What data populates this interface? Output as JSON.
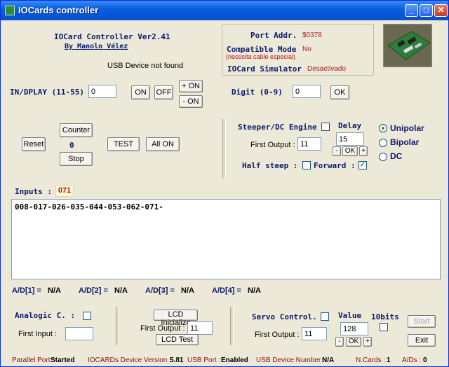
{
  "window": {
    "title": "IOCards controller",
    "min": "_",
    "max": "□",
    "close": "✕"
  },
  "header": {
    "app_name": "IOCard Controller  Ver2.41",
    "author": "By Manolo Vélez",
    "usb_status": "USB Device not found",
    "port_addr_label": "Port Addr.",
    "port_addr_value": "$0378",
    "compatible_label": "Compatible Mode",
    "compatible_value": "No",
    "compatible_note": "(necesita cable especial)",
    "simulator_label": "IOCard Simulator",
    "simulator_value": "Desactivado"
  },
  "display": {
    "label": "IN/DPLAY (11-55)",
    "value": "0",
    "on": "ON",
    "off": "OFF",
    "plus_on": "+ ON",
    "minus_on": "- ON",
    "digit_label": "Digit (0-9)",
    "digit_value": "0",
    "ok": "OK"
  },
  "counter": {
    "reset": "Reset",
    "counter": "Counter",
    "value": "0",
    "stop": "Stop",
    "test": "TEST",
    "all_on": "All ON"
  },
  "stepper": {
    "engine_label": "Steeper/DC Engine",
    "delay_label": "Delay",
    "delay_value": "15",
    "first_output_label": "First Output :",
    "first_output_value": "11",
    "half_steep_label": "Half steep :",
    "forward_label": "Forward :",
    "forward_check": "✓",
    "minus": "-",
    "ok": "OK",
    "plus": "+",
    "modes": [
      "Unipolar",
      "Bipolar",
      "DC"
    ]
  },
  "inputs": {
    "label": "Inputs :",
    "value": "071",
    "log": "008-017-026-035-044-053-062-071-"
  },
  "ad": [
    {
      "label": "A/D[1] =",
      "value": "N/A"
    },
    {
      "label": "A/D[2] =",
      "value": "N/A"
    },
    {
      "label": "A/D[3] =",
      "value": "N/A"
    },
    {
      "label": "A/D[4] =",
      "value": "N/A"
    }
  ],
  "analogic": {
    "label": "Analogic C. :",
    "first_input_label": "First Input :",
    "first_input_value": ""
  },
  "lcd": {
    "init": "LCD Inicialize",
    "first_output_label": "First Output :",
    "first_output_value": "11",
    "test": "LCD Test"
  },
  "servo": {
    "label": "Servo Control.",
    "value_label": "Value",
    "bits_label": "10bits",
    "first_output_label": "First Output :",
    "first_output_value": "11",
    "value": "128",
    "minus": "-",
    "ok": "OK",
    "plus": "+",
    "start": "Start",
    "exit": "Exit"
  },
  "status": {
    "parallel_label": "Parallel Port :",
    "parallel_value": "Started",
    "version_label": "IOCARDs Device  Version :",
    "version_value": "5.81",
    "usb_label": "USB Port :",
    "usb_value": "Enabled",
    "usb_num_label": "USB Device Number :",
    "usb_num_value": "N/A",
    "ncards_label": "N.Cards :",
    "ncards_value": "1",
    "ads_label": "A/Ds :",
    "ads_value": "0"
  }
}
